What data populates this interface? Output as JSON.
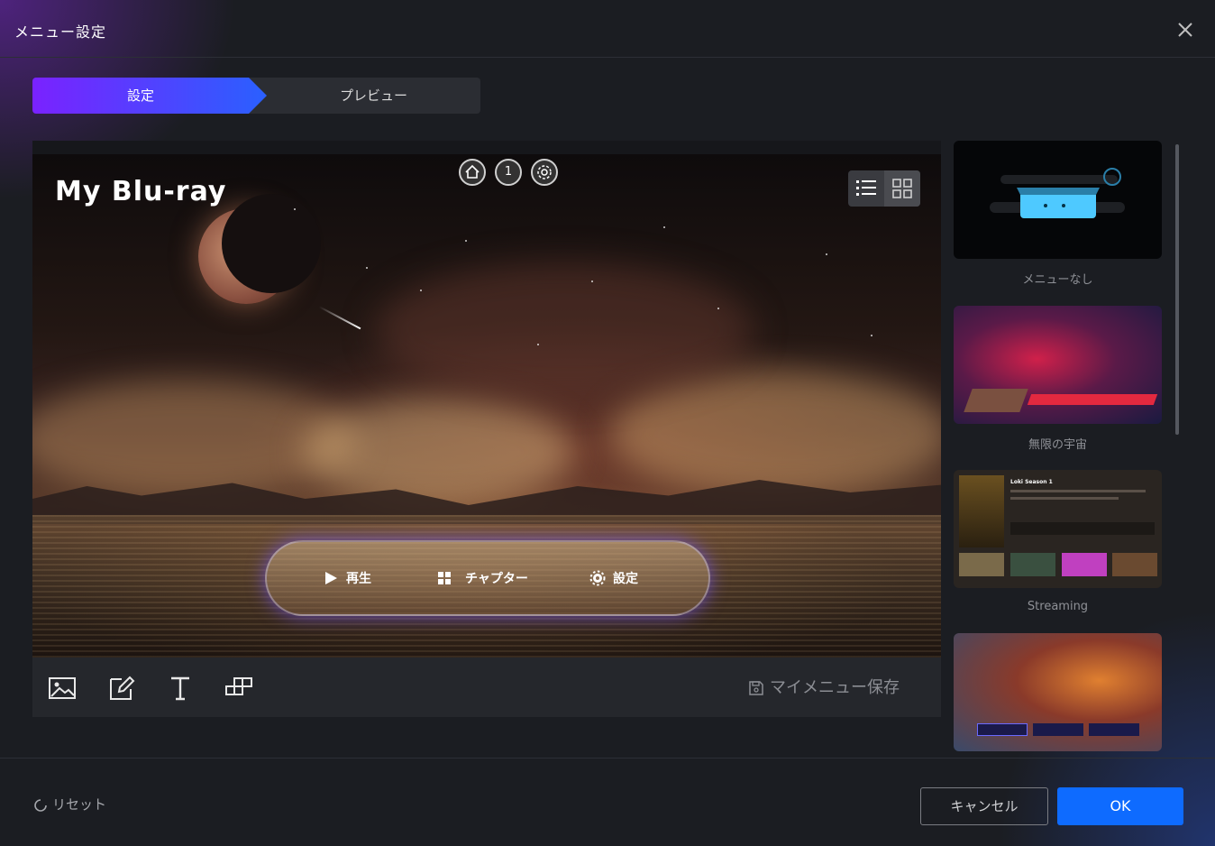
{
  "window": {
    "title": "メニュー設定"
  },
  "tabs": [
    {
      "label": "設定",
      "active": true
    },
    {
      "label": "プレビュー",
      "active": false
    }
  ],
  "canvas": {
    "disc_title": "My Blu-ray",
    "nav_buttons": [
      {
        "icon": "home-icon"
      },
      {
        "label": "1"
      },
      {
        "icon": "gear-icon"
      }
    ],
    "menu_items": [
      {
        "icon": "play-icon",
        "label": "再生"
      },
      {
        "icon": "grid-icon",
        "label": "チャプター"
      },
      {
        "icon": "gear-icon",
        "label": "設定"
      }
    ]
  },
  "toolbar": {
    "tools": [
      "image-icon",
      "edit-icon",
      "text-icon",
      "layout-icon"
    ],
    "save_label": "マイメニュー保存"
  },
  "templates": [
    {
      "label": "メニューなし",
      "selected": true
    },
    {
      "label": "無限の宇宙"
    },
    {
      "label": "Streaming",
      "thumb_title": "Loki Season 1"
    },
    {
      "label": ""
    }
  ],
  "footer": {
    "reset_label": "リセット",
    "cancel_label": "キャンセル",
    "ok_label": "OK"
  },
  "colors": {
    "accent": "#0e6bff",
    "tab_gradient_start": "#7a22ff",
    "tab_gradient_end": "#2a60ff",
    "glow": "#6e50e6"
  }
}
